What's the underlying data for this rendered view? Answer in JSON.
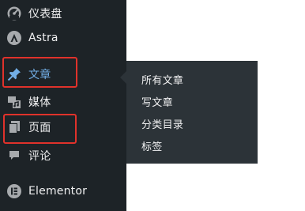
{
  "sidebar": {
    "items": [
      {
        "label": "仪表盘",
        "icon": "dashboard-icon"
      },
      {
        "label": "Astra",
        "icon": "astra-logo-icon"
      },
      {
        "label": "文章",
        "icon": "pin-icon",
        "active": true
      },
      {
        "label": "媒体",
        "icon": "media-icon"
      },
      {
        "label": "页面",
        "icon": "pages-icon"
      },
      {
        "label": "评论",
        "icon": "comment-icon"
      },
      {
        "label": "Elementor",
        "icon": "elementor-icon"
      }
    ]
  },
  "flyout": {
    "items": [
      {
        "label": "所有文章"
      },
      {
        "label": "写文章"
      },
      {
        "label": "分类目录"
      },
      {
        "label": "标签"
      }
    ]
  },
  "colors": {
    "sidebar_bg": "#1d2327",
    "flyout_bg": "#2c3338",
    "text": "#f0f0f1",
    "active_text": "#72aee6",
    "icon": "#a7aaad",
    "annotation_red": "#e0322b"
  }
}
